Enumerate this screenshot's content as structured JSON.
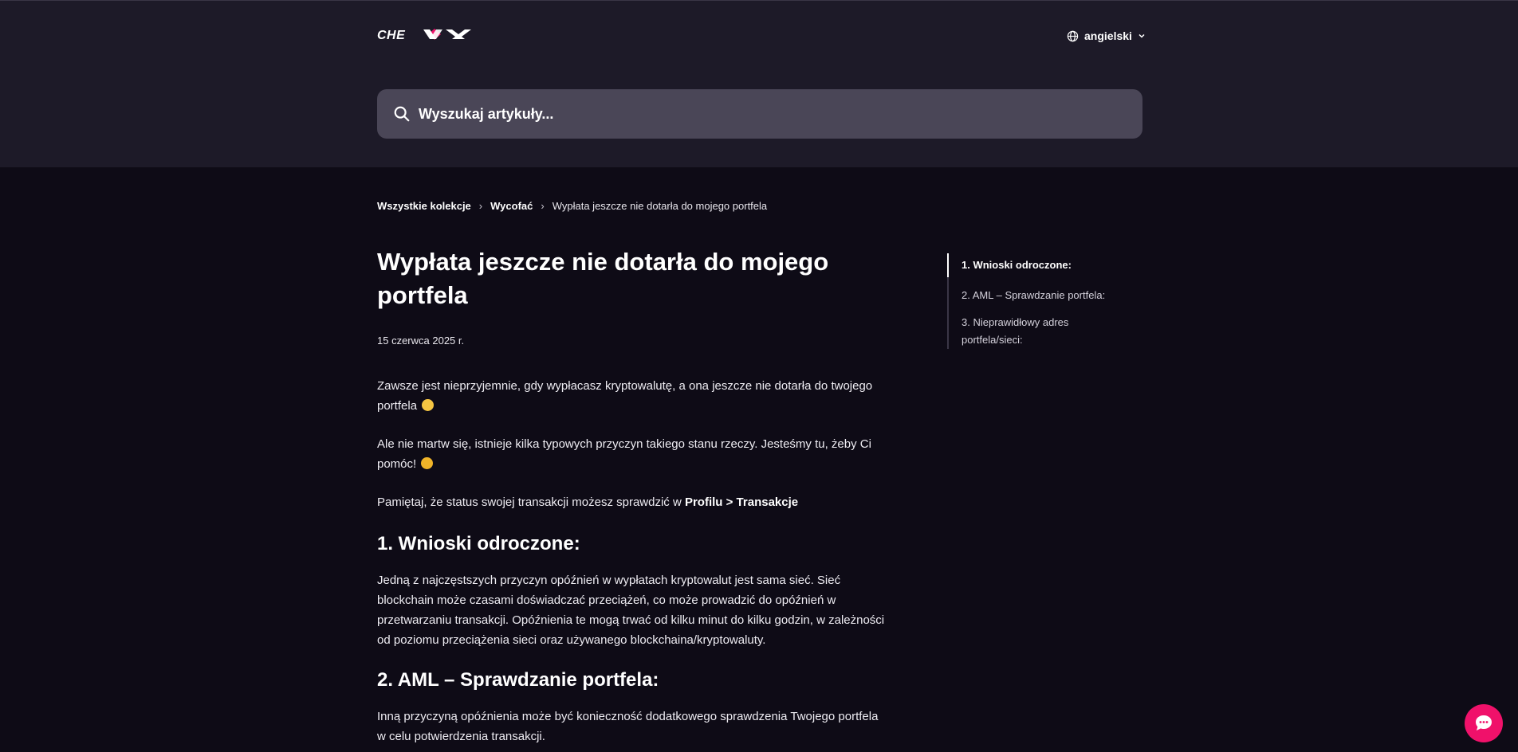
{
  "header": {
    "logo_text": "CHEXX",
    "language": "angielski",
    "search_placeholder": "Wyszukaj artykuły..."
  },
  "breadcrumb": {
    "root": "Wszystkie kolekcje",
    "collection": "Wycofać",
    "current": "Wypłata jeszcze nie dotarła do mojego portfela",
    "separator": "›"
  },
  "article": {
    "title": "Wypłata jeszcze nie dotarła do mojego portfela",
    "date": "15 czerwca 2025 r.",
    "para1": "Zawsze jest nieprzyjemnie, gdy wypłacasz kryptowalutę, a ona jeszcze nie dotarła do twojego portfela",
    "para2": "Ale nie martw się, istnieje kilka typowych przyczyn takiego stanu rzeczy. Jesteśmy tu, żeby Ci pomóc!",
    "para3_prefix": "Pamiętaj, że status swojej transakcji możesz sprawdzić w",
    "para3_bold": "Profilu > Transakcje",
    "section1_title": "1. Wnioski odroczone:",
    "section1_text": "Jedną z najczęstszych przyczyn opóźnień w wypłatach kryptowalut jest sama sieć. Sieć blockchain może czasami doświadczać przeciążeń, co może prowadzić do opóźnień w przetwarzaniu transakcji. Opóźnienia te mogą trwać od kilku minut do kilku godzin, w zależności od poziomu przeciążenia sieci oraz używanego blockchaina/kryptowaluty.",
    "section2_title": "2. AML – Sprawdzanie portfela:",
    "section2_text": "Inną przyczyną opóźnienia może być konieczność dodatkowego sprawdzenia Twojego portfela w celu potwierdzenia transakcji."
  },
  "toc": {
    "items": [
      "1. Wnioski odroczone:",
      "2. AML – Sprawdzanie portfela:",
      "3. Nieprawidłowy adres portfela/sieci:"
    ]
  },
  "colors": {
    "header_bg": "#1d1a28",
    "page_bg": "#0e0b16",
    "search_bg": "#4a4657",
    "accent": "#f0116a"
  },
  "icons": {
    "language": "globe-icon",
    "dropdown": "chevron-down-icon",
    "search": "search-icon",
    "chat": "chat-bubble-icon"
  }
}
